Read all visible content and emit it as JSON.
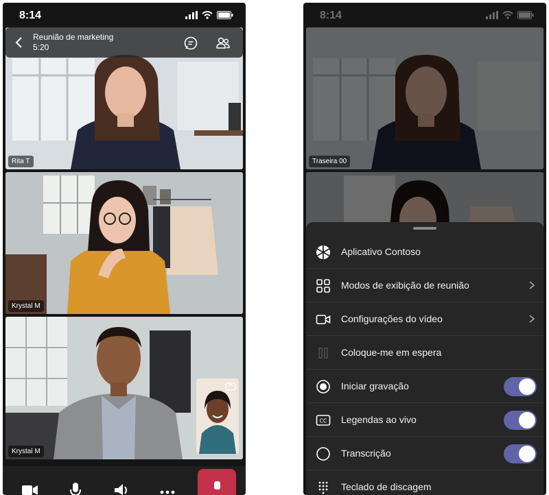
{
  "status_bar": {
    "time": "8:14"
  },
  "meeting": {
    "title": "Reunião de marketing",
    "elapsed": "5:20"
  },
  "participants": [
    {
      "name": "Rita T"
    },
    {
      "name": "Krystal M"
    },
    {
      "name": "Krystal M"
    }
  ],
  "right_screen": {
    "participant_tag": "Traseira 00"
  },
  "menu": {
    "items": [
      {
        "label": "Aplicativo Contoso",
        "icon": "contoso-app-icon"
      },
      {
        "label": "Modos de exibição de reunião",
        "icon": "grid-icon",
        "chevron": true
      },
      {
        "label": "Configurações do vídeo",
        "icon": "video-camera-icon",
        "chevron": true
      },
      {
        "label": "Coloque-me em espera",
        "icon": "pause-icon"
      },
      {
        "label": "Iniciar gravação",
        "icon": "record-icon",
        "toggle": true
      },
      {
        "label": "Legendas ao vivo",
        "icon": "captions-icon",
        "toggle": true
      },
      {
        "label": "Transcrição",
        "icon": "transcription-icon",
        "toggle": true
      },
      {
        "label": "Teclado de discagem",
        "icon": "dialpad-icon"
      }
    ]
  },
  "colors": {
    "toggle_on": "#6264a7",
    "hangup": "#c4314b",
    "sheet": "#262626"
  }
}
